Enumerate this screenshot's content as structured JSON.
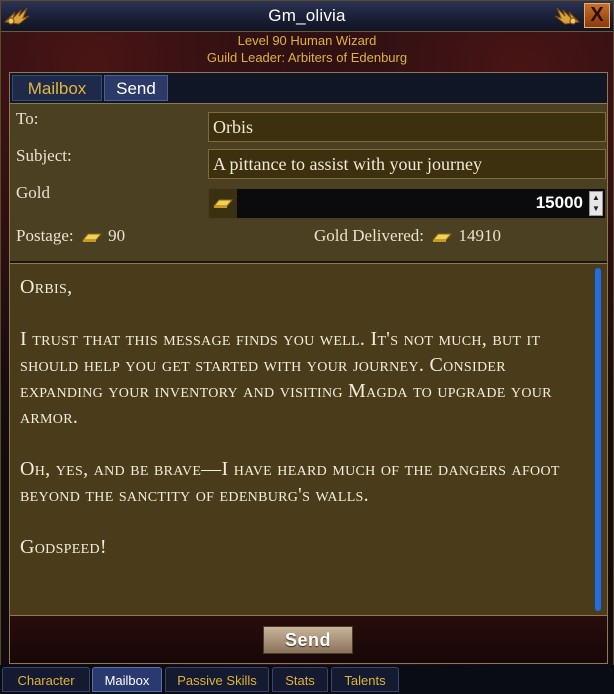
{
  "window": {
    "title": "Gm_olivia",
    "subtitle_line1": "Level 90 Human Wizard",
    "subtitle_line2": "Guild Leader: Arbiters of Edenburg",
    "close_label": "X"
  },
  "tabs": [
    {
      "label": "Mailbox"
    },
    {
      "label": "Send"
    }
  ],
  "form": {
    "to_label": "To:",
    "to_value": "Orbis",
    "subject_label": "Subject:",
    "subject_value": "A pittance to assist with your journey",
    "gold_label": "Gold",
    "gold_value": "15000",
    "postage_label": "Postage:",
    "postage_value": "90",
    "delivered_label": "Gold Delivered:",
    "delivered_value": "14910"
  },
  "message": {
    "body": "Orbis,\n\nI trust that this message finds you well. It's not much, but it should help you get started with your journey. Consider expanding your inventory and visiting Magda to upgrade your armor.\n\nOh, yes, and be brave—I have heard much of the dangers afoot beyond the sanctity of edenburg's walls.\n\nGodspeed!"
  },
  "send_label": "Send",
  "bottom_tabs": [
    {
      "label": "Character"
    },
    {
      "label": "Mailbox"
    },
    {
      "label": "Passive Skills"
    },
    {
      "label": "Stats"
    },
    {
      "label": "Talents"
    }
  ],
  "active_bottom_tab": "Mailbox",
  "colors": {
    "accent_gold": "#e0b23c",
    "scrollbar": "#1e6ee8"
  },
  "icons": [
    "wing-emblem-icon",
    "close-icon",
    "gold-bar-icon",
    "spinner-up-icon",
    "spinner-down-icon"
  ]
}
